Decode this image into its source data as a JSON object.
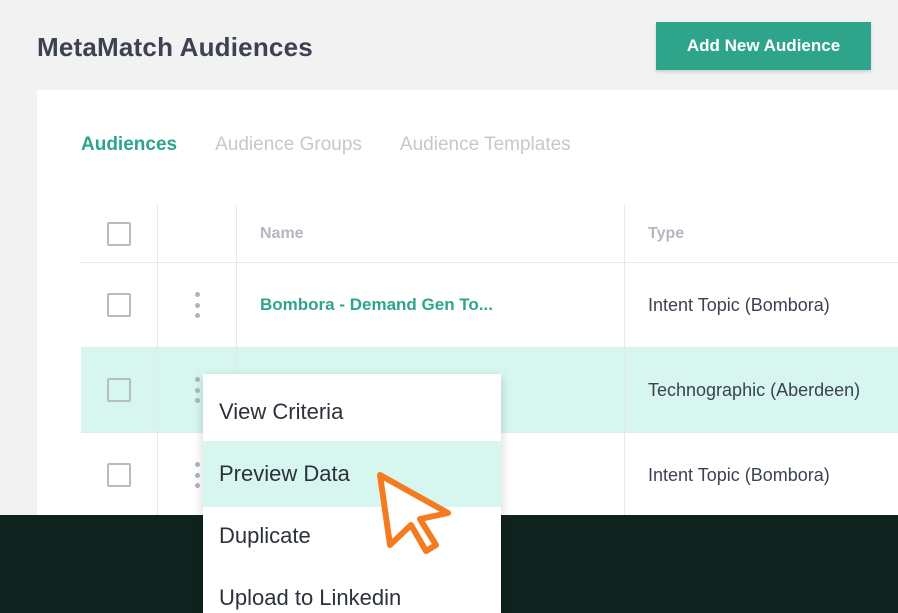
{
  "page": {
    "title": "MetaMatch Audiences",
    "add_button_label": "Add New Audience"
  },
  "tabs": [
    {
      "label": "Audiences",
      "active": true
    },
    {
      "label": "Audience Groups",
      "active": false
    },
    {
      "label": "Audience Templates",
      "active": false
    }
  ],
  "table": {
    "columns": {
      "name": "Name",
      "type": "Type"
    },
    "rows": [
      {
        "name": "Bombora - Demand Gen To...",
        "type": "Intent Topic (Bombora)",
        "highlighted": false
      },
      {
        "name": "",
        "type": "Technographic (Aberdeen)",
        "highlighted": true
      },
      {
        "name": "",
        "type": "Intent Topic (Bombora)",
        "highlighted": false
      }
    ]
  },
  "context_menu": {
    "items": [
      {
        "label": "View Criteria",
        "hovered": false
      },
      {
        "label": "Preview Data",
        "hovered": true
      },
      {
        "label": "Duplicate",
        "hovered": false
      },
      {
        "label": "Upload to Linkedin",
        "hovered": false
      }
    ]
  },
  "colors": {
    "accent": "#2ea58a",
    "highlight": "#d6f6ef",
    "cursor": "#f47b20",
    "dark_band": "#0f221d"
  },
  "icons": {
    "row_menu": "kebab-menu-icon",
    "pointer": "mouse-pointer-icon"
  }
}
